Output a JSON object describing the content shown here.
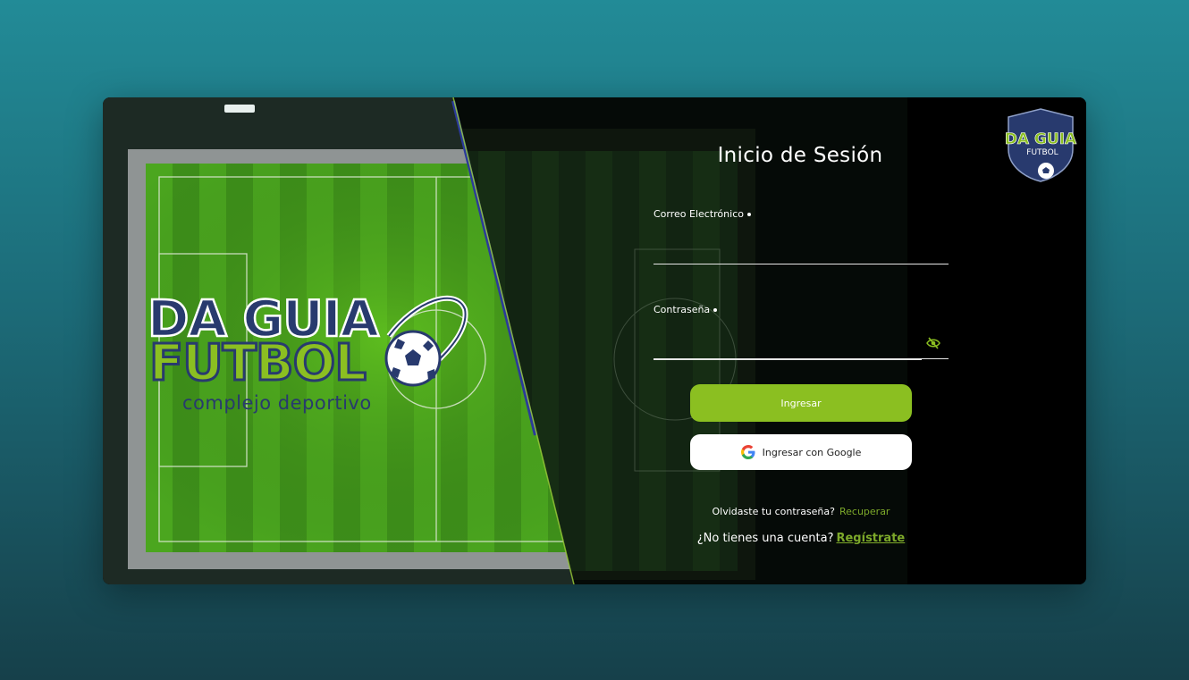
{
  "brand": {
    "logo_line1": "DA GUIA",
    "logo_line2": "FUTBOL",
    "tagline": "complejo deportivo",
    "badge_line1": "DA GUIA",
    "badge_line2": "FUTBOL"
  },
  "form": {
    "title": "Inicio de Sesión",
    "email_label": "Correo Electrónico",
    "email_value": "",
    "password_label": "Contraseña",
    "password_value": "",
    "login_button": "Ingresar",
    "google_button": "Ingresar con Google",
    "forgot_text": "Olvidaste tu contraseña?",
    "forgot_link": "Recuperar",
    "register_text": "¿No tienes una cuenta?",
    "register_link": "Regístrate"
  },
  "icons": {
    "password_toggle": "eye-slash-icon",
    "google": "google-icon"
  },
  "colors": {
    "accent": "#8bbf21",
    "link": "#7da92a",
    "brand_navy": "#283a6e",
    "page_bg_top": "#228b97",
    "page_bg_bottom": "#16404a"
  }
}
